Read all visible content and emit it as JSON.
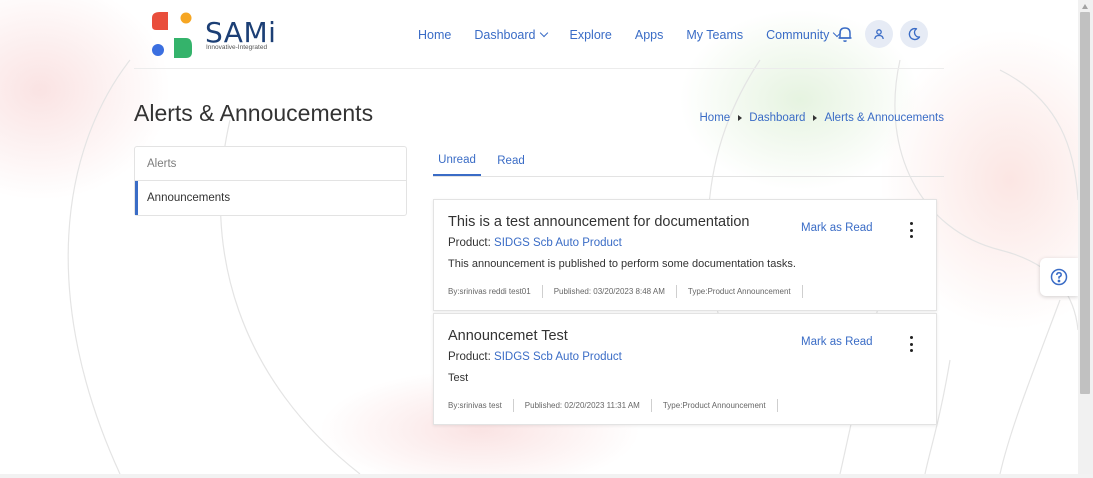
{
  "brand": {
    "name": "SAMi",
    "tagline": "Innovative-Integrated",
    "colors": {
      "red": "#e94e3c",
      "orange": "#f6a623",
      "blue": "#3b6fe0",
      "green": "#34b36b",
      "navy": "#1c3f75"
    }
  },
  "nav": {
    "items": [
      {
        "label": "Home",
        "has_dropdown": false
      },
      {
        "label": "Dashboard",
        "has_dropdown": true
      },
      {
        "label": "Explore",
        "has_dropdown": false
      },
      {
        "label": "Apps",
        "has_dropdown": false
      },
      {
        "label": "My Teams",
        "has_dropdown": false
      },
      {
        "label": "Community",
        "has_dropdown": true
      }
    ],
    "icons": [
      "bell-icon",
      "user-icon",
      "moon-icon"
    ]
  },
  "page": {
    "title": "Alerts & Annoucements",
    "breadcrumbs": [
      "Home",
      "Dashboard",
      "Alerts & Annoucements"
    ]
  },
  "side_menu": {
    "items": [
      {
        "label": "Alerts",
        "active": false
      },
      {
        "label": "Announcements",
        "active": true
      }
    ]
  },
  "tabs": [
    {
      "label": "Unread",
      "active": true
    },
    {
      "label": "Read",
      "active": false
    }
  ],
  "announcements": [
    {
      "title": "This is a test announcement for documentation",
      "product_label": "Product:",
      "product_name": "SIDGS Scb Auto Product",
      "description": "This announcement is published to perform some documentation tasks.",
      "by": "By:srinivas reddi test01",
      "published": "Published: 03/20/2023 8:48 AM",
      "type": "Type:Product Announcement",
      "action_label": "Mark as Read"
    },
    {
      "title": "Announcemet Test",
      "product_label": "Product:",
      "product_name": "SIDGS Scb Auto Product",
      "description": "Test",
      "by": "By:srinivas test",
      "published": "Published: 02/20/2023 11:31 AM",
      "type": "Type:Product Announcement",
      "action_label": "Mark as Read"
    }
  ],
  "colors": {
    "accent": "#3a6cc6",
    "text": "#333333"
  }
}
